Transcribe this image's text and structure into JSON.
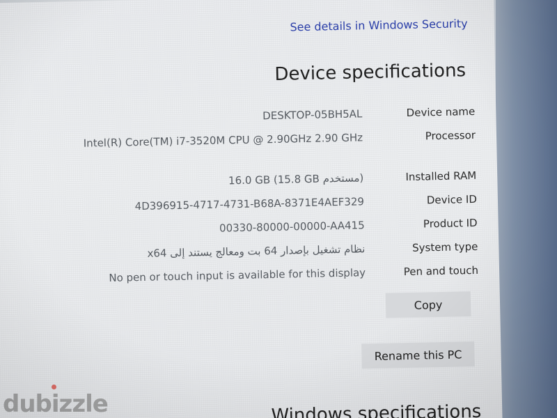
{
  "security_link": "See details in Windows Security",
  "device_specs": {
    "heading": "Device specifications",
    "rows": [
      {
        "label": "Device name",
        "value": "DESKTOP-05BH5AL"
      },
      {
        "label": "Processor",
        "value": "Intel(R) Core(TM) i7-3520M CPU @ 2.90GHz   2.90 GHz"
      },
      {
        "label": "Installed RAM",
        "value": "16.0 GB (15.8 GB مستخدم)"
      },
      {
        "label": "Device ID",
        "value": "4D396915-4717-4731-B68A-8371E4AEF329"
      },
      {
        "label": "Product ID",
        "value": "00330-80000-00000-AA415"
      },
      {
        "label": "System type",
        "value": "نظام تشغيل بإصدار 64 بت ومعالج يستند إلى x64"
      },
      {
        "label": "Pen and touch",
        "value": "No pen or touch input is available for this display"
      }
    ],
    "copy_label": "Copy",
    "rename_label": "Rename this PC"
  },
  "windows_specs": {
    "heading": "Windows specifications"
  },
  "watermark": {
    "text": "dubizzle"
  }
}
